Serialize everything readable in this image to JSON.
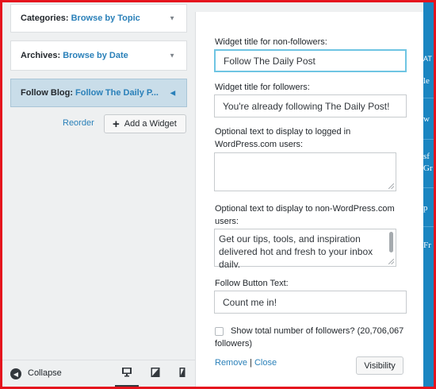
{
  "sidebar": {
    "sections": [
      {
        "prefix": "Categories:",
        "link": "Browse by Topic"
      },
      {
        "prefix": "Archives:",
        "link": "Browse by Date"
      },
      {
        "prefix": "Follow Blog:",
        "link": "Follow The Daily P..."
      }
    ],
    "reorder_label": "Reorder",
    "add_widget_label": "Add a Widget",
    "collapse_label": "Collapse"
  },
  "widget": {
    "title_non_followers_label": "Widget title for non-followers:",
    "title_non_followers_value": "Follow The Daily Post",
    "title_followers_label": "Widget title for followers:",
    "title_followers_value": "You're already following The Daily Post!",
    "logged_in_text_label": "Optional text to display to logged in WordPress.com users:",
    "logged_in_text_value": "",
    "non_wp_text_label": "Optional text to display to non-WordPress.com users:",
    "non_wp_text_value": "Get our tips, tools, and inspiration delivered hot and fresh to your inbox daily.",
    "follow_button_label": "Follow Button Text:",
    "follow_button_value": "Count me in!",
    "show_followers_label": "Show total number of followers? (20,706,067",
    "show_followers_label_cont": "followers)",
    "show_followers_checked": false,
    "remove_label": "Remove",
    "link_separator": "|",
    "close_label": "Close",
    "visibility_label": "Visibility"
  },
  "preview_strip": {
    "fragments": [
      "AT",
      "le",
      "w",
      "sf",
      "Gr",
      "p",
      "Fr"
    ]
  },
  "colors": {
    "accent_link": "#2a80b9",
    "frame_border": "#e5141e",
    "focus_ring": "#6fc5e3",
    "preview_bg": "#1a85c1",
    "selected_section_bg": "#c9dde9"
  },
  "icons": [
    "chevron-down-icon",
    "chevron-left-icon",
    "plus-icon",
    "collapse-icon",
    "desktop-icon",
    "tablet-icon",
    "mobile-icon",
    "resize-grip-icon"
  ]
}
